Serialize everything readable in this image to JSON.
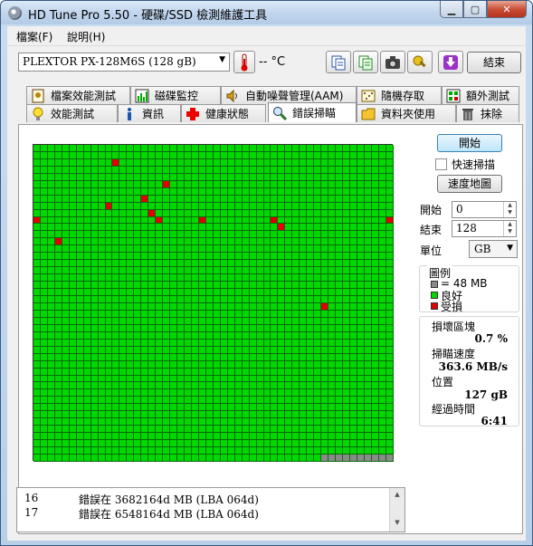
{
  "window": {
    "title": "HD Tune Pro 5.50 - 硬碟/SSD 檢測維護工具"
  },
  "menu": {
    "file": "檔案(F)",
    "help": "說明(H)"
  },
  "toolbar": {
    "drive": "PLEXTOR PX-128M6S (128 gB)",
    "temperature": "-- °C",
    "exit_label": "結束"
  },
  "tabs_top": [
    {
      "label": "檔案效能測試",
      "icon": "file-benchmark-icon"
    },
    {
      "label": "磁碟監控",
      "icon": "disk-monitor-icon"
    },
    {
      "label": "自動噪聲管理(AAM)",
      "icon": "speaker-icon"
    },
    {
      "label": "隨機存取",
      "icon": "random-access-icon"
    },
    {
      "label": "額外測試",
      "icon": "extra-tests-icon"
    }
  ],
  "tabs_bottom": [
    {
      "label": "效能測試",
      "icon": "lightbulb-icon"
    },
    {
      "label": "資訊",
      "icon": "info-icon"
    },
    {
      "label": "健康狀態",
      "icon": "health-cross-icon"
    },
    {
      "label": "錯誤掃瞄",
      "icon": "magnifier-icon"
    },
    {
      "label": "資料夾使用",
      "icon": "folder-icon"
    },
    {
      "label": "抹除",
      "icon": "trash-icon"
    }
  ],
  "active_tab": "錯誤掃瞄",
  "scan": {
    "start_button": "開始",
    "quick_scan_label": "快速掃描",
    "quick_scan_checked": false,
    "speed_map_button": "速度地圖",
    "start_label": "開始",
    "start_value": "0",
    "end_label": "結束",
    "end_value": "128",
    "unit_label": "單位",
    "unit_value": "GB"
  },
  "legend": {
    "title": "圖例",
    "block_size": "= 48 MB",
    "good": "良好",
    "damaged": "受損",
    "colors": {
      "unscanned": "#8a8a8a",
      "good": "#00d800",
      "damaged": "#e00000"
    }
  },
  "stats": {
    "damaged_blocks_label": "損壞區塊",
    "damaged_blocks_value": "0.7 %",
    "scan_speed_label": "掃瞄速度",
    "scan_speed_value": "363.6 MB/s",
    "position_label": "位置",
    "position_value": "127 gB",
    "elapsed_label": "經過時間",
    "elapsed_value": "6:41"
  },
  "block_map": {
    "columns": 50,
    "rows": 44,
    "damaged_blocks": [
      [
        2,
        11
      ],
      [
        5,
        18
      ],
      [
        7,
        15
      ],
      [
        8,
        10
      ],
      [
        9,
        16
      ],
      [
        10,
        0
      ],
      [
        10,
        17
      ],
      [
        10,
        23
      ],
      [
        10,
        33
      ],
      [
        10,
        49
      ],
      [
        11,
        34
      ],
      [
        13,
        3
      ],
      [
        22,
        40
      ]
    ],
    "unscanned_tail": {
      "row": 43,
      "from_col": 40,
      "to_col": 49
    }
  },
  "log": [
    {
      "no": "16",
      "message": "錯誤在 3682164d MB (LBA 064d)"
    },
    {
      "no": "17",
      "message": "錯誤在 6548164d MB (LBA 064d)"
    }
  ]
}
